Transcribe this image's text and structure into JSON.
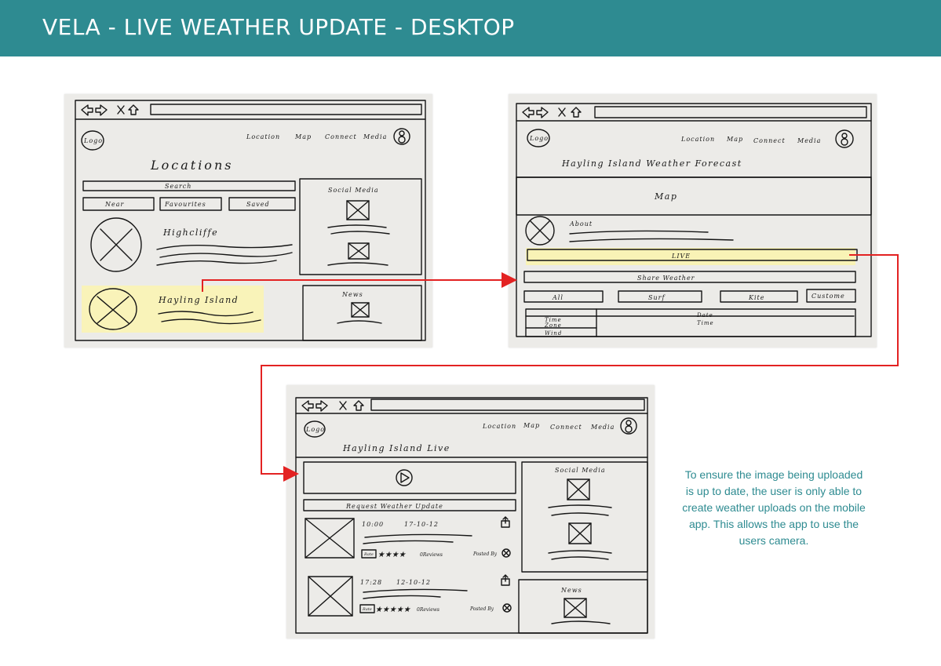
{
  "header": {
    "title": "VELA - LIVE WEATHER UPDATE - DESKTOP",
    "bg_color": "#2e8b91"
  },
  "common": {
    "logo": "Logo",
    "nav": [
      "Location",
      "Map",
      "Connect",
      "Media"
    ],
    "profile_icon": "user-avatar-icon"
  },
  "sketch1": {
    "title": "Locations",
    "search": "Search",
    "tabs": [
      "Near",
      "Favourites",
      "Saved"
    ],
    "location1": "Highcliffe",
    "location2": "Hayling Island",
    "social": "Social Media",
    "news": "News"
  },
  "sketch2": {
    "title": "Hayling Island Weather Forecast",
    "map": "Map",
    "about": "About",
    "live": "LIVE",
    "share": "Share Weather",
    "filters": [
      "All",
      "Surf",
      "Kite",
      "Custome"
    ],
    "table_left": [
      "Time",
      "Zone",
      "Wind"
    ],
    "table_right": [
      "Date",
      "Time"
    ]
  },
  "sketch3": {
    "title": "Hayling Island Live",
    "request": "Request Weather Update",
    "post1": {
      "time": "10:00",
      "date": "17-10-12",
      "rate": "Rate",
      "stars": "★★★★",
      "reviews": "0Reviews",
      "posted": "Posted By"
    },
    "post2": {
      "time": "17:28",
      "date": "12-10-12",
      "rate": "Rate",
      "stars": "★★★★★",
      "reviews": "0Reviews",
      "posted": "Posted By"
    },
    "social": "Social Media",
    "news": "News"
  },
  "note": "To ensure the image being uploaded is up to date, the user is only able to create weather uploads on the mobile app. This allows the app to use the users camera.",
  "colors": {
    "accent": "#2e8b91",
    "arrow": "#e32222",
    "highlight": "#fbf4b0",
    "paper": "#ecebe8"
  }
}
